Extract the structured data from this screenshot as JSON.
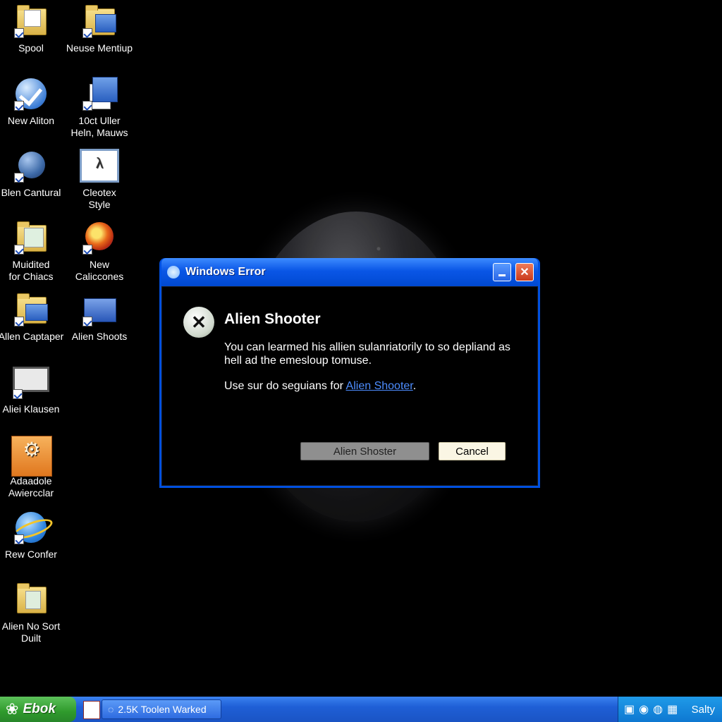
{
  "desktop": {
    "icons": [
      {
        "label": "Spool"
      },
      {
        "label": "Neuse Mentiup"
      },
      {
        "label": "New Aliton"
      },
      {
        "label": "10ct Uller\nHeln, Mauws"
      },
      {
        "label": "Blen Cantural"
      },
      {
        "label": "Cleotex\nStyle"
      },
      {
        "label": "Muidited\nfor Chiacs"
      },
      {
        "label": "New Caliccones"
      },
      {
        "label": "Allen Captaper"
      },
      {
        "label": "Alien Shoots"
      },
      {
        "label": "Aliei Klausen"
      },
      {
        "label": "Adaadole\nAwiercclar"
      },
      {
        "label": "Rew Confer"
      },
      {
        "label": "Alien No Sort\nDuilt"
      }
    ]
  },
  "dialog": {
    "title": "Windows Error",
    "heading": "Alien Shooter",
    "message": "You can learmed his allien sulanriatorily to so depliand as hell ad the emesloup tomuse.",
    "line2_prefix": "Use sur do seguians for ",
    "link_text": "Alien Shooter",
    "line2_suffix": ".",
    "primary_button": "Alien Shoster",
    "cancel_button": "Cancel",
    "close_glyph": "✕",
    "error_glyph": "✕"
  },
  "taskbar": {
    "start_label": "Ebok",
    "task_label": "2.5K  Toolen Warked",
    "tray_label": "Salty"
  }
}
